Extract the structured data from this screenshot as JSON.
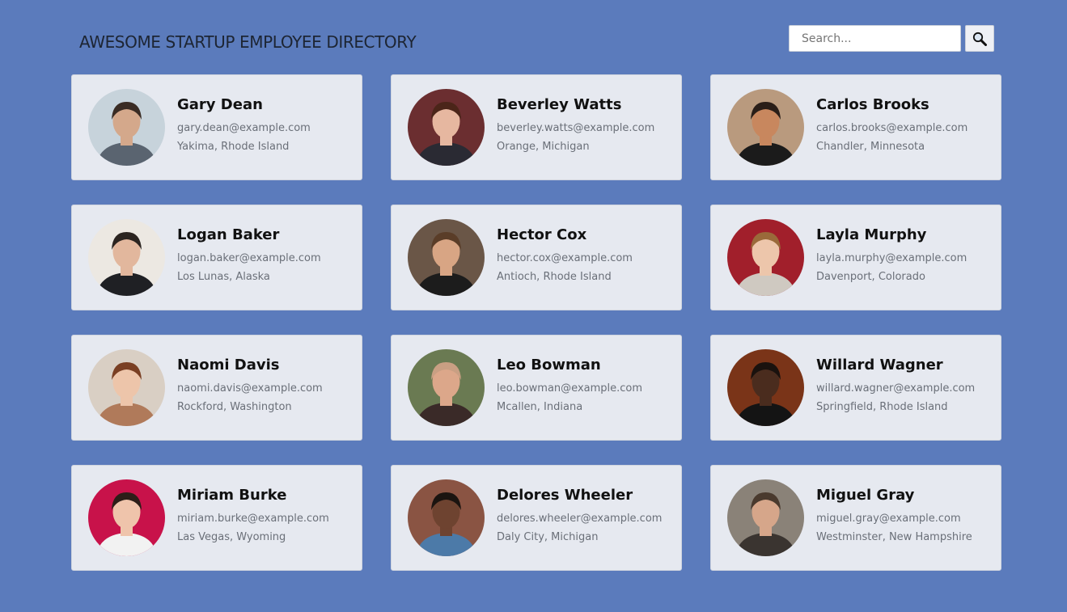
{
  "header": {
    "title": "AWESOME STARTUP EMPLOYEE DIRECTORY"
  },
  "search": {
    "placeholder": "Search...",
    "value": "",
    "button_icon": "magnifier-icon"
  },
  "employees": [
    {
      "name": "Gary Dean",
      "email": "gary.dean@example.com",
      "location": "Yakima, Rhode Island",
      "bg": "#c7d3db",
      "skin": "#d4a88b",
      "hair": "#3a2c24",
      "shirt": "#5a6470"
    },
    {
      "name": "Beverley Watts",
      "email": "beverley.watts@example.com",
      "location": "Orange, Michigan",
      "bg": "#6b2e30",
      "skin": "#e6b7a0",
      "hair": "#4b2519",
      "shirt": "#2a2a33"
    },
    {
      "name": "Carlos Brooks",
      "email": "carlos.brooks@example.com",
      "location": "Chandler, Minnesota",
      "bg": "#b99a7e",
      "skin": "#c8875e",
      "hair": "#2a1e18",
      "shirt": "#1b1b1b"
    },
    {
      "name": "Logan Baker",
      "email": "logan.baker@example.com",
      "location": "Los Lunas, Alaska",
      "bg": "#ece8e2",
      "skin": "#e2b79d",
      "hair": "#2b2420",
      "shirt": "#1f2024"
    },
    {
      "name": "Hector Cox",
      "email": "hector.cox@example.com",
      "location": "Antioch, Rhode Island",
      "bg": "#6a5647",
      "skin": "#d8a584",
      "hair": "#5a3d28",
      "shirt": "#1c1c1c"
    },
    {
      "name": "Layla Murphy",
      "email": "layla.murphy@example.com",
      "location": "Davenport, Colorado",
      "bg": "#a11f2b",
      "skin": "#edc6ab",
      "hair": "#9a6a3a",
      "shirt": "#cfc9c1"
    },
    {
      "name": "Naomi Davis",
      "email": "naomi.davis@example.com",
      "location": "Rockford, Washington",
      "bg": "#d9cfc4",
      "skin": "#edc5aa",
      "hair": "#7a3f23",
      "shirt": "#b07a5a"
    },
    {
      "name": "Leo Bowman",
      "email": "leo.bowman@example.com",
      "location": "Mcallen, Indiana",
      "bg": "#6a7a52",
      "skin": "#dca78a",
      "hair": "#c99f83",
      "shirt": "#3a2a28"
    },
    {
      "name": "Willard Wagner",
      "email": "willard.wagner@example.com",
      "location": "Springfield, Rhode Island",
      "bg": "#7a3418",
      "skin": "#4a2c1e",
      "hair": "#1a120e",
      "shirt": "#141414"
    },
    {
      "name": "Miriam Burke",
      "email": "miriam.burke@example.com",
      "location": "Las Vegas, Wyoming",
      "bg": "#c8124a",
      "skin": "#efc4ab",
      "hair": "#2c1e18",
      "shirt": "#f2f2f2"
    },
    {
      "name": "Delores Wheeler",
      "email": "delores.wheeler@example.com",
      "location": "Daly City, Michigan",
      "bg": "#8a5443",
      "skin": "#6e4330",
      "hair": "#1b1410",
      "shirt": "#4c7aa8"
    },
    {
      "name": "Miguel Gray",
      "email": "miguel.gray@example.com",
      "location": "Westminster, New Hampshire",
      "bg": "#8a8278",
      "skin": "#d6a68a",
      "hair": "#4a3a2e",
      "shirt": "#3a3430"
    }
  ]
}
